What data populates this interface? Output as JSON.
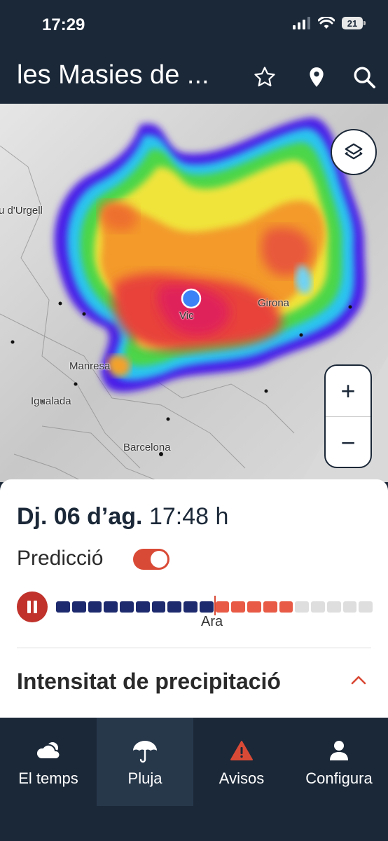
{
  "status_bar": {
    "time": "17:29",
    "battery": "21"
  },
  "header": {
    "title": "les Masies de ...",
    "icons": [
      "star-icon",
      "location-pin-icon",
      "search-icon"
    ]
  },
  "map": {
    "labels": {
      "urgell": "u d'Urgell",
      "vic": "Vic",
      "girona": "Girona",
      "manresa": "Manresa",
      "igualada": "Igualada",
      "barcelona": "Barcelona"
    },
    "zoom_in": "+",
    "zoom_out": "−",
    "layers_icon": "layers-icon",
    "location_marker_color": "#3b82f6"
  },
  "panel": {
    "date": "Dj. 06 d’ag.",
    "time": "17:48 h",
    "prediction_label": "Predicció",
    "prediction_enabled": true,
    "timeline": {
      "past_segments": 10,
      "forecast_segments": 5,
      "future_segments": 5,
      "now_label": "Ara"
    },
    "section_title": "Intensitat de precipitació"
  },
  "tabs": [
    {
      "label": "El temps",
      "icon": "cloud-icon",
      "active": false
    },
    {
      "label": "Pluja",
      "icon": "umbrella-icon",
      "active": true
    },
    {
      "label": "Avisos",
      "icon": "warning-icon",
      "active": false
    },
    {
      "label": "Configura",
      "icon": "user-icon",
      "active": false
    }
  ],
  "colors": {
    "navy": "#1b2838",
    "accent_red": "#d94a36",
    "past_bar": "#1e2a6e",
    "forecast_bar": "#e85a45",
    "future_bar": "#dedede"
  }
}
